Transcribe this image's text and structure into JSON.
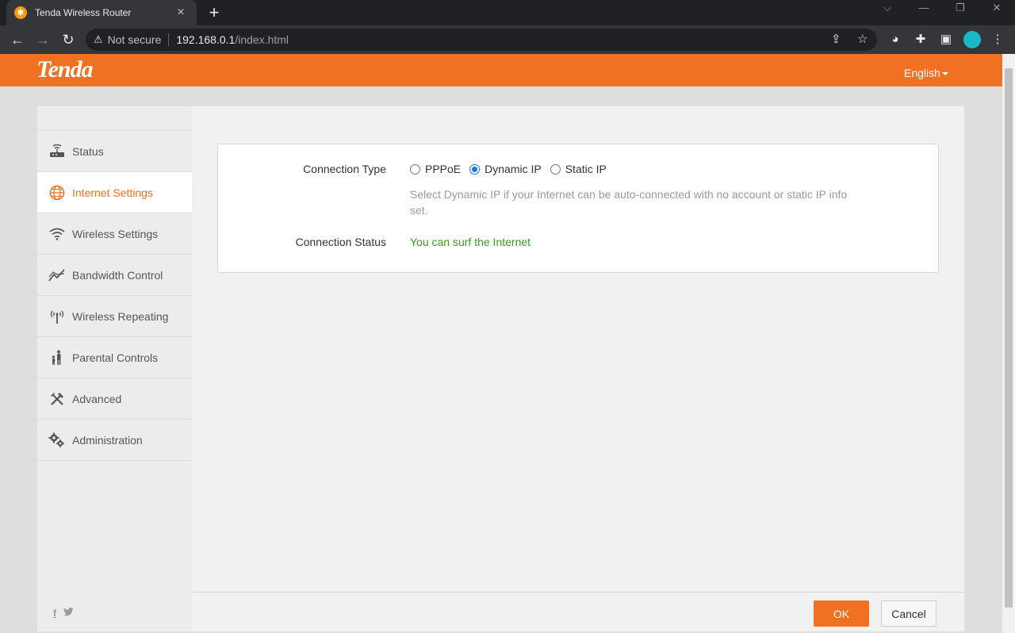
{
  "browser": {
    "tab_title": "Tenda Wireless Router",
    "tab_close": "×",
    "new_tab": "+",
    "security_label": "Not secure",
    "url_host": "192.168.0.1",
    "url_path": "/index.html"
  },
  "header": {
    "logo": "Tenda",
    "language": "English"
  },
  "sidebar": {
    "items": [
      {
        "label": "Status",
        "icon": "router-icon"
      },
      {
        "label": "Internet Settings",
        "icon": "globe-icon",
        "active": true
      },
      {
        "label": "Wireless Settings",
        "icon": "wifi-icon"
      },
      {
        "label": "Bandwidth Control",
        "icon": "chart-line-icon"
      },
      {
        "label": "Wireless Repeating",
        "icon": "antenna-icon"
      },
      {
        "label": "Parental Controls",
        "icon": "family-icon"
      },
      {
        "label": "Advanced",
        "icon": "tools-icon"
      },
      {
        "label": "Administration",
        "icon": "gears-icon"
      }
    ],
    "social": {
      "facebook": "f",
      "twitter": "t"
    }
  },
  "main": {
    "connection_type_label": "Connection Type",
    "options": [
      "PPPoE",
      "Dynamic IP",
      "Static IP"
    ],
    "selected_option": "Dynamic IP",
    "hint": "Select Dynamic IP if your Internet can be auto-connected with no account or static IP info set.",
    "connection_status_label": "Connection Status",
    "connection_status": "You can surf the Internet"
  },
  "footer": {
    "ok_label": "OK",
    "cancel_label": "Cancel"
  },
  "colors": {
    "brand": "#f07122",
    "status_ok": "#3a9a1c"
  }
}
